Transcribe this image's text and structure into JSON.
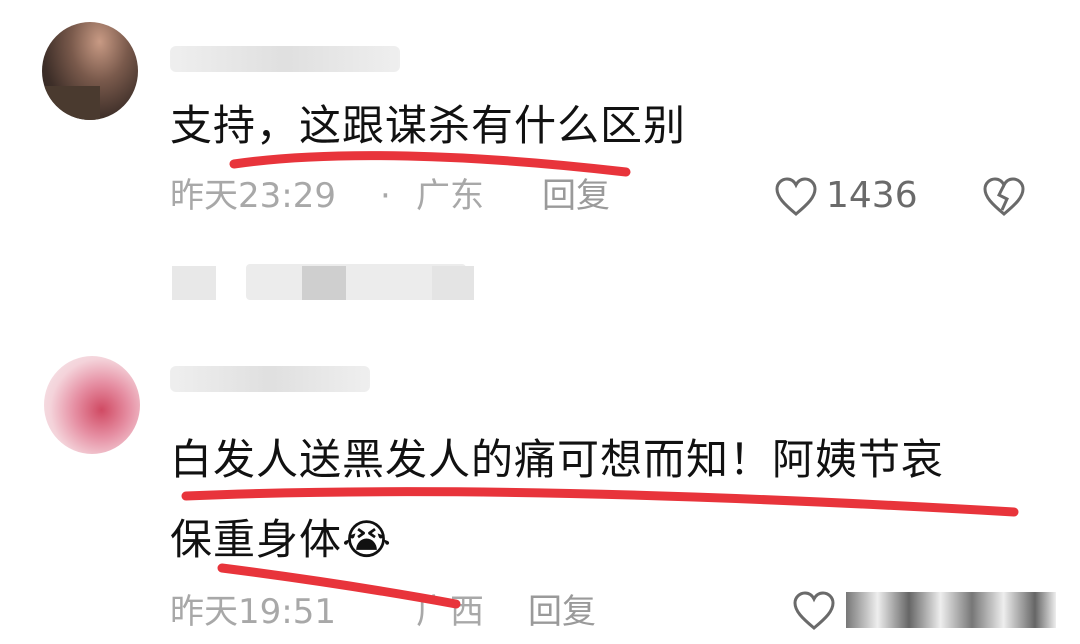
{
  "comments": [
    {
      "text": "支持，这跟谋杀有什么区别",
      "time": "昨天23:29",
      "separator": "·",
      "location": "广东",
      "reply_label": "回复",
      "likes": "1436"
    },
    {
      "text_line1": "白发人送黑发人的痛可想而知！阿姨节哀",
      "text_line2": "保重身体",
      "emoji": "😭",
      "time": "昨天19:51",
      "location": "广西",
      "reply_label": "回复"
    }
  ],
  "colors": {
    "underline": "#e8343b",
    "meta": "#a8a8a8",
    "text": "#111111"
  },
  "icons": [
    "heart-outline-icon",
    "broken-heart-icon"
  ]
}
